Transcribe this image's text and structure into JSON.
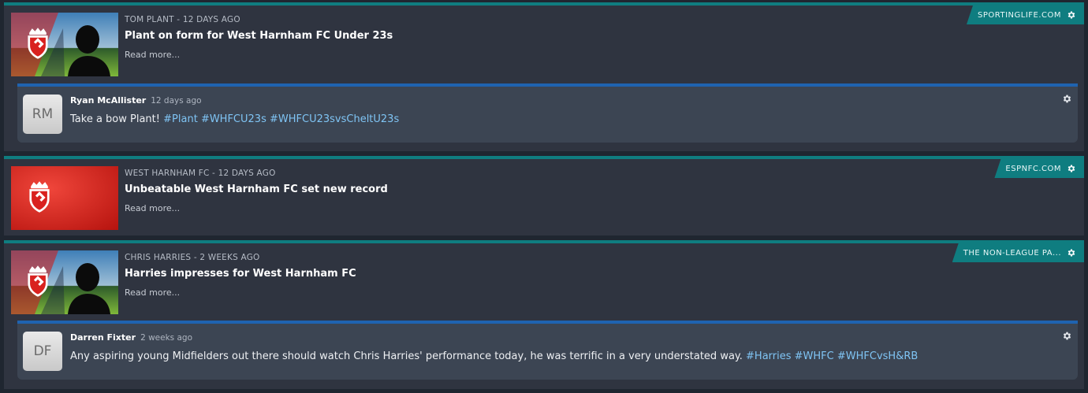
{
  "feed": [
    {
      "source": "SPORTINGLIFE.COM",
      "meta": "TOM PLANT - 12 DAYS AGO",
      "headline": "Plant on form for West Harnham FC Under 23s",
      "read_more": "Read more...",
      "thumb_type": "player",
      "tweet": {
        "initials": "RM",
        "name": "Ryan McAllister",
        "time": "12 days ago",
        "text": "Take a bow Plant!",
        "tags": [
          "#Plant",
          "#WHFCU23s",
          "#WHFCU23svsCheltU23s"
        ]
      }
    },
    {
      "source": "ESPNFC.COM",
      "meta": "WEST HARNHAM FC - 12 DAYS AGO",
      "headline": "Unbeatable West Harnham FC set new record",
      "read_more": "Read more...",
      "thumb_type": "club"
    },
    {
      "source": "THE NON-LEAGUE PA...",
      "meta": "CHRIS HARRIES - 2 WEEKS AGO",
      "headline": "Harries impresses for West Harnham FC",
      "read_more": "Read more...",
      "thumb_type": "player",
      "tweet": {
        "initials": "DF",
        "name": "Darren Fixter",
        "time": "2 weeks ago",
        "text": "Any aspiring young Midfielders out there should watch Chris Harries' performance today, he was terrific in a very understated way.",
        "tags": [
          "#Harries",
          "#WHFC",
          "#WHFCvsH&RB"
        ]
      }
    }
  ],
  "colors": {
    "accent_teal": "#0f7d80",
    "tweet_blue": "#1f63b0",
    "hashtag": "#7fc4f4",
    "club_red": "#d9211f"
  },
  "icons": {
    "source_settings": "gear-icon",
    "tweet_settings": "gear-icon"
  }
}
